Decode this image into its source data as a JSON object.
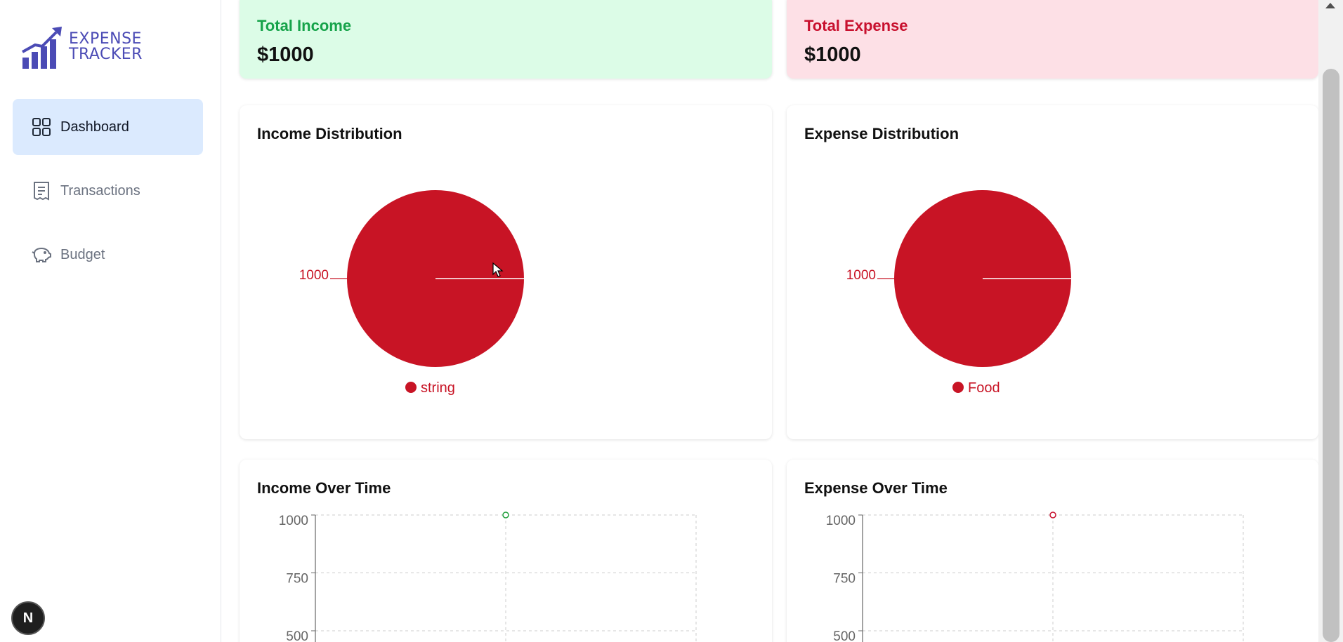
{
  "sidebar": {
    "logo": {
      "line1": "EXPENSE",
      "line2": "TRACKER",
      "icon": "growth-chart-icon",
      "color": "#4b4bb5"
    },
    "items": [
      {
        "label": "Dashboard",
        "icon": "dashboard-grid-icon",
        "active": true
      },
      {
        "label": "Transactions",
        "icon": "receipt-icon",
        "active": false
      },
      {
        "label": "Budget",
        "icon": "piggy-bank-icon",
        "active": false
      }
    ],
    "badge": "N"
  },
  "summary": {
    "income": {
      "title": "Total Income",
      "value": "$1000",
      "color": "#16a34a",
      "bg": "#dcfce7"
    },
    "expense": {
      "title": "Total Expense",
      "value": "$1000",
      "color": "#c8102e",
      "bg": "#fde0e6"
    }
  },
  "chart_data": [
    {
      "type": "pie",
      "title": "Income Distribution",
      "slices": [
        {
          "label": "string",
          "value": 1000,
          "color": "#c81425"
        }
      ]
    },
    {
      "type": "pie",
      "title": "Expense Distribution",
      "slices": [
        {
          "label": "Food",
          "value": 1000,
          "color": "#c81425"
        }
      ]
    },
    {
      "type": "line",
      "title": "Income Over Time",
      "yticks": [
        1000,
        750,
        500
      ],
      "ylim": [
        0,
        1000
      ],
      "points": [
        {
          "y": 1000
        }
      ],
      "color": "#22a03c",
      "grid": true
    },
    {
      "type": "line",
      "title": "Expense Over Time",
      "yticks": [
        1000,
        750,
        500
      ],
      "ylim": [
        0,
        1000
      ],
      "points": [
        {
          "y": 1000
        }
      ],
      "color": "#c8102e",
      "grid": true
    }
  ]
}
